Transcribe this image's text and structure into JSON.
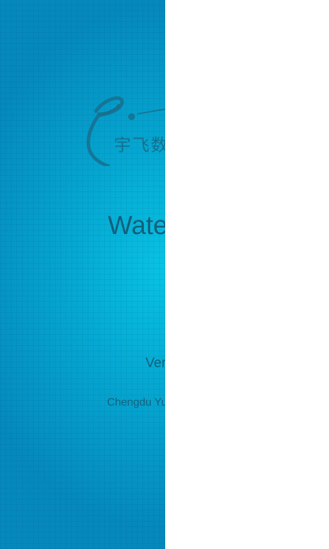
{
  "splash": {
    "logo_text": "宇飞数",
    "title": "Watermar",
    "version": "Versio",
    "company": "Chengdu Yufei Informat"
  },
  "colors": {
    "panel_blue": "#05a8d2",
    "text": "#12607d",
    "background": "#ffffff"
  }
}
